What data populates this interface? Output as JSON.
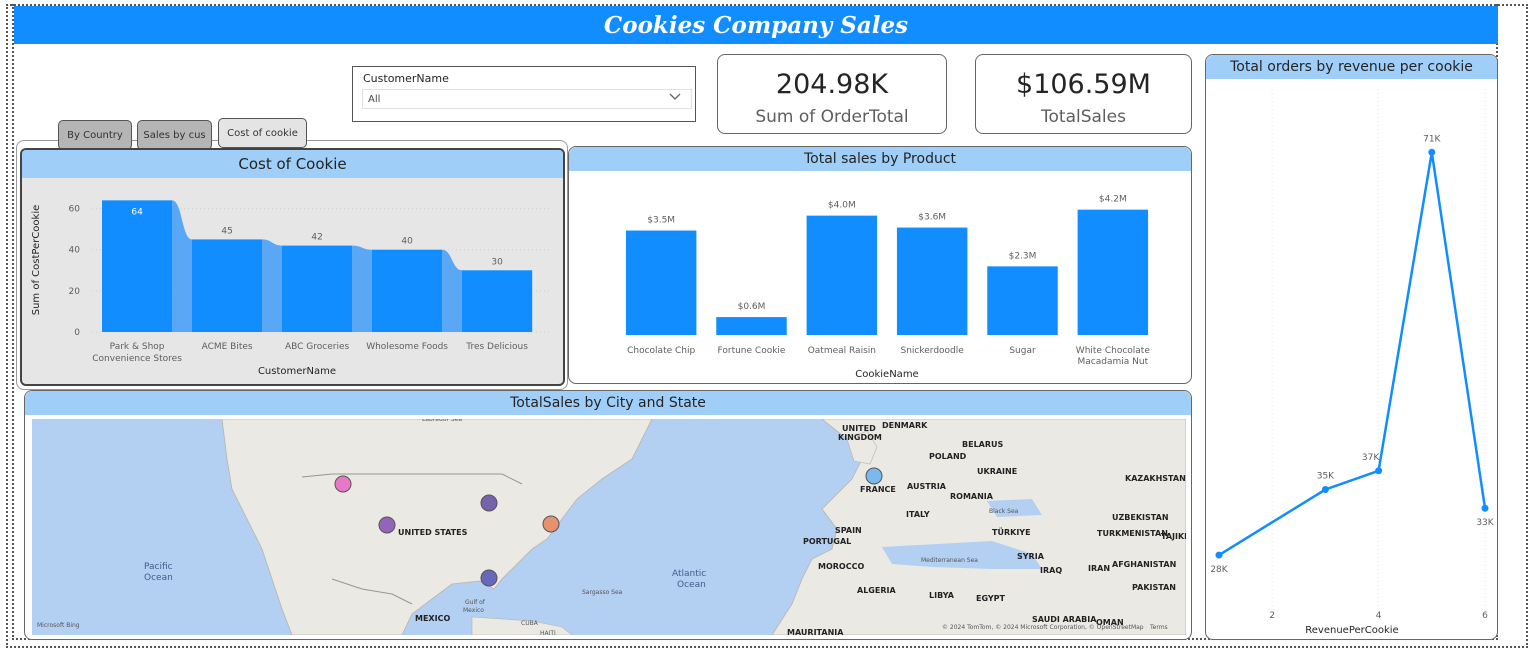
{
  "title": "Cookies Company Sales",
  "slicer": {
    "label": "CustomerName",
    "value": "All"
  },
  "kpis": [
    {
      "value": "204.98K",
      "caption": "Sum of OrderTotal"
    },
    {
      "value": "$106.59M",
      "caption": "TotalSales"
    }
  ],
  "tabs": [
    {
      "label": "By Country",
      "active": false
    },
    {
      "label": "Sales by cus",
      "active": false
    },
    {
      "label": "Cost of cookie",
      "active": true
    }
  ],
  "cost_chart": {
    "header": "Cost of Cookie",
    "chart_data": {
      "type": "bar",
      "categories": [
        "Park & Shop Convenience Stores",
        "ACME Bites",
        "ABC Groceries",
        "Wholesome Foods",
        "Tres Delicious"
      ],
      "category_lines": [
        [
          "Park & Shop",
          "Convenience Stores"
        ],
        [
          "ACME Bites"
        ],
        [
          "ABC Groceries"
        ],
        [
          "Wholesome Foods"
        ],
        [
          "Tres Delicious"
        ]
      ],
      "values": [
        64,
        45,
        42,
        40,
        30
      ],
      "xlabel": "CustomerName",
      "ylabel": "Sum of CostPerCookie",
      "yticks": [
        0,
        20,
        40,
        60
      ],
      "ylim": [
        0,
        70
      ]
    }
  },
  "product_chart": {
    "header": "Total sales by Product",
    "chart_data": {
      "type": "bar",
      "categories": [
        "Chocolate Chip",
        "Fortune Cookie",
        "Oatmeal Raisin",
        "Snickerdoodle",
        "Sugar",
        "White Chocolate Macadamia Nut"
      ],
      "category_lines": [
        [
          "Chocolate Chip"
        ],
        [
          "Fortune Cookie"
        ],
        [
          "Oatmeal Raisin"
        ],
        [
          "Snickerdoodle"
        ],
        [
          "Sugar"
        ],
        [
          "White Chocolate",
          "Macadamia Nut"
        ]
      ],
      "values": [
        3.5,
        0.6,
        4.0,
        3.6,
        2.3,
        4.2
      ],
      "data_labels": [
        "$3.5M",
        "$0.6M",
        "$4.0M",
        "$3.6M",
        "$2.3M",
        "$4.2M"
      ],
      "xlabel": "CookieName",
      "ylim": [
        0,
        4.5
      ]
    }
  },
  "map": {
    "header": "TotalSales by City and State",
    "labels": {
      "united_states": "UNITED STATES",
      "pacific": [
        "Pacific",
        "Ocean"
      ],
      "atlantic": [
        "Atlantic",
        "Ocean"
      ],
      "gulf": [
        "Gulf of",
        "Mexico"
      ],
      "sargasso": "Sargasso Sea",
      "mexico": "MEXICO",
      "cuba": "CUBA",
      "haiti": "HAITI",
      "united_kingdom": [
        "UNITED",
        "KINGDOM"
      ],
      "denmark": "DENMARK",
      "belarus": "BELARUS",
      "poland": "POLAND",
      "ukraine": "UKRAINE",
      "france": "FRANCE",
      "austria": "AUSTRIA",
      "romania": "ROMANIA",
      "kazakhstan": "KAZAKHSTAN",
      "italy": "ITALY",
      "black_sea": "Black Sea",
      "uzbekistan": "UZBEKISTAN",
      "turkmenistan": "TURKMENISTAN",
      "tajikistan": "TAJIKISTA",
      "spain": "SPAIN",
      "portugal": "PORTUGAL",
      "turkiye": "TÜRKIYE",
      "syria": "SYRIA",
      "iraq": "IRAQ",
      "iran": "IRAN",
      "afghanistan": "AFGHANISTAN",
      "pakistan": "PAKISTAN",
      "morocco": "MOROCCO",
      "mediterranean": "Mediterranean Sea",
      "algeria": "ALGERIA",
      "libya": "LIBYA",
      "egypt": "EGYPT",
      "saudi": "SAUDI ARABIA",
      "oman": "OMAN",
      "mauritania": "MAURITANIA",
      "labrador": "Labrador Sea",
      "bing": "Microsoft Bing",
      "copyright": "© 2024 TomTom, © 2024 Microsoft Corporation, © OpenStreetMap",
      "terms": "Terms"
    },
    "bubble_colors": [
      "#e66ec4",
      "#8b58b5",
      "#6b57a8",
      "#e58a62",
      "#5b5bb8",
      "#6fb4ef"
    ]
  },
  "line_chart": {
    "header": "Total orders by revenue per cookie",
    "chart_data": {
      "type": "line",
      "x": [
        1,
        3,
        4,
        5,
        6
      ],
      "y": [
        28,
        35,
        37,
        71,
        33
      ],
      "data_labels": [
        "28K",
        "35K",
        "37K",
        "71K",
        "33K"
      ],
      "xticks": [
        2,
        4,
        6
      ],
      "xlabel": "RevenuePerCookie",
      "xlim": [
        1,
        6
      ],
      "ylim": [
        20,
        80
      ]
    }
  },
  "colors": {
    "accent": "#118dff",
    "header_bg": "#9fcff9",
    "bar": "#118dff",
    "bar_dark": "#5aa8f5"
  }
}
